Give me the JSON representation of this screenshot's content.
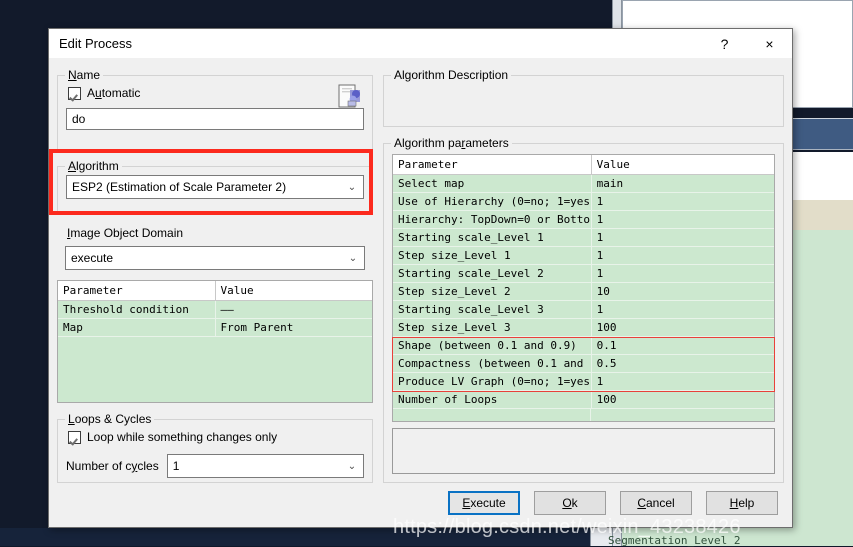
{
  "window": {
    "title": "Edit Process",
    "help_button": "?",
    "close_button": "×"
  },
  "left": {
    "name_group": {
      "legend": "Name",
      "legend_accel": "N",
      "automatic_checkbox": {
        "label": "Automatic",
        "checked": true,
        "accel": "u"
      },
      "name_value": "do",
      "icon": "document-copy-icon"
    },
    "algorithm_group": {
      "legend": "Algorithm",
      "legend_accel": "A",
      "selected": "ESP2 (Estimation of Scale Parameter 2)",
      "arrow": "⌄",
      "highlight_color": "#fc2a1e"
    },
    "domain_group": {
      "legend": "Image Object Domain",
      "legend_accel": "I",
      "selected": "execute",
      "arrow": "⌄"
    },
    "domain_table": {
      "columns": [
        "Parameter",
        "Value"
      ],
      "rows": [
        [
          "Threshold condition",
          "——"
        ],
        [
          "Map",
          "From Parent"
        ]
      ]
    },
    "loops_group": {
      "legend": "Loops & Cycles",
      "legend_accel": "L",
      "loop_checkbox": {
        "label": "Loop while something changes only",
        "checked": true
      },
      "cycles_label": "Number of cycles",
      "cycles_accel": "y",
      "cycles_value": "1",
      "arrow": "⌄"
    }
  },
  "right": {
    "description_group": {
      "legend": "Algorithm Description",
      "legend_accel": "A",
      "text": ""
    },
    "parameters_group": {
      "legend": "Algorithm parameters",
      "legend_accel": "p"
    },
    "parameters_table": {
      "columns": [
        "Parameter",
        "Value"
      ],
      "rows": [
        [
          "Select map",
          "main"
        ],
        [
          "Use of Hierarchy (0=no; 1=yes)",
          "1"
        ],
        [
          "Hierarchy: TopDown=0 or Botto...",
          "1"
        ],
        [
          "Starting scale_Level 1",
          "1"
        ],
        [
          "Step size_Level 1",
          "1"
        ],
        [
          "Starting scale_Level 2",
          "1"
        ],
        [
          "Step size_Level 2",
          "10"
        ],
        [
          "Starting scale_Level 3",
          "1"
        ],
        [
          "Step size_Level 3",
          "100"
        ],
        [
          "Shape (between 0.1 and 0.9)",
          "0.1"
        ],
        [
          "Compactness (between 0.1 and ...",
          "0.5"
        ],
        [
          "Produce LV Graph (0=no; 1=yes)",
          "1"
        ],
        [
          "Number of Loops",
          "100"
        ]
      ],
      "highlighted_rows": [
        9,
        10,
        11
      ],
      "highlight_color": "#e8413a"
    }
  },
  "buttons": [
    {
      "label": "Execute",
      "accel": "E",
      "focused": true
    },
    {
      "label": "Ok",
      "accel": "O",
      "focused": false
    },
    {
      "label": "Cancel",
      "accel": "C",
      "focused": false
    },
    {
      "label": "Help",
      "accel": "H",
      "focused": false
    }
  ],
  "watermark": {
    "url": "https://blog.csdn.net/weixin_43238426",
    "partial_text": "Segmentation_Level 2"
  }
}
